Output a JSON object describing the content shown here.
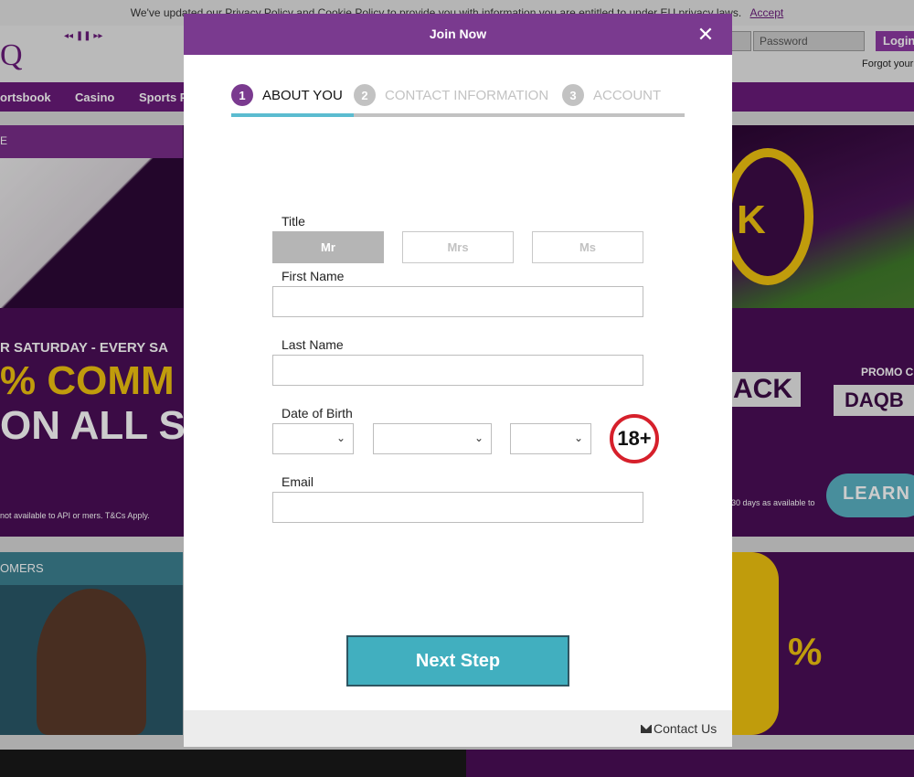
{
  "background": {
    "cookie_text": "We've updated our Privacy Policy and Cookie Policy to provide you with information you are entitled to under EU privacy laws.",
    "cookie_accept": "Accept",
    "logo": "Q",
    "ticker": "◂◂ ❚❚ ▸▸",
    "password_placeholder": "Password",
    "login_label": "Login",
    "forgot_label": "Forgot your",
    "nav": [
      "ortsbook",
      "Casino",
      "Sports P"
    ],
    "banner1_stripe": "E",
    "banner2_saturday": "R SATURDAY - EVERY SA",
    "banner2_comm": "% COMM",
    "banner2_all": "ON ALL S",
    "banner2_small": "not available to API or mers. T&Cs Apply.",
    "banner2_ack": "ACK",
    "banner2_promo": "PROMO C",
    "banner2_code": "DAQB",
    "banner2_days": "30 days as available to",
    "learn_label": "LEARN",
    "banner3_bar": "OMERS",
    "banner4_pct": "%"
  },
  "modal": {
    "title": "Join Now",
    "close_symbol": "✕",
    "steps": [
      {
        "num": "1",
        "label": "ABOUT YOU"
      },
      {
        "num": "2",
        "label": "CONTACT INFORMATION"
      },
      {
        "num": "3",
        "label": "ACCOUNT"
      }
    ],
    "progress_fraction": 0.27,
    "title_label": "Title",
    "title_options": [
      "Mr",
      "Mrs",
      "Ms"
    ],
    "selected_title": "Mr",
    "first_name_label": "First Name",
    "first_name_value": "",
    "last_name_label": "Last Name",
    "last_name_value": "",
    "dob_label": "Date of Birth",
    "dob_day": "",
    "dob_month": "",
    "dob_year": "",
    "age_badge": "18+",
    "email_label": "Email",
    "email_value": "",
    "next_label": "Next Step",
    "contact_label": "Contact Us"
  },
  "colors": {
    "brand_purple": "#7a3a8f",
    "accent_teal": "#41afbf",
    "progress_blue": "#5bbcd0",
    "age_red": "#d6202b"
  }
}
